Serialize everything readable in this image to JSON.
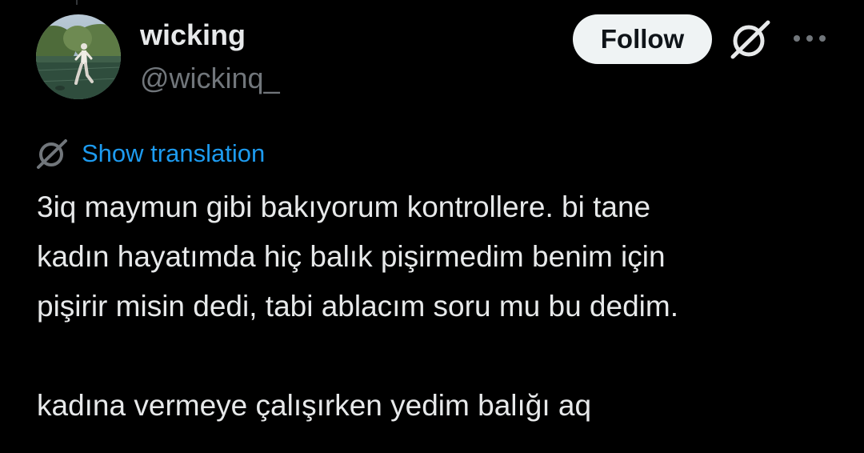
{
  "author": {
    "display_name": "wicking",
    "handle": "@wickinq_",
    "avatar_icon": "user-avatar-photo"
  },
  "actions": {
    "follow_label": "Follow",
    "grok_icon": "grok-icon",
    "more_icon": "more-horizontal-icon"
  },
  "translation": {
    "icon": "grok-icon",
    "link_label": "Show translation"
  },
  "tweet": {
    "lines": [
      "3iq maymun gibi bakıyorum kontrollere. bi tane",
      "kadın hayatımda hiç balık pişirmedim benim için",
      "pişirir misin dedi, tabi ablacım soru mu bu dedim.",
      "",
      "kadına vermeye çalışırken yedim balığı aq"
    ]
  },
  "colors": {
    "background": "#000000",
    "text_primary": "#e7e9ea",
    "text_secondary": "#71767b",
    "link": "#1d9bf0",
    "follow_bg": "#eff3f4",
    "follow_text": "#0f1419"
  }
}
